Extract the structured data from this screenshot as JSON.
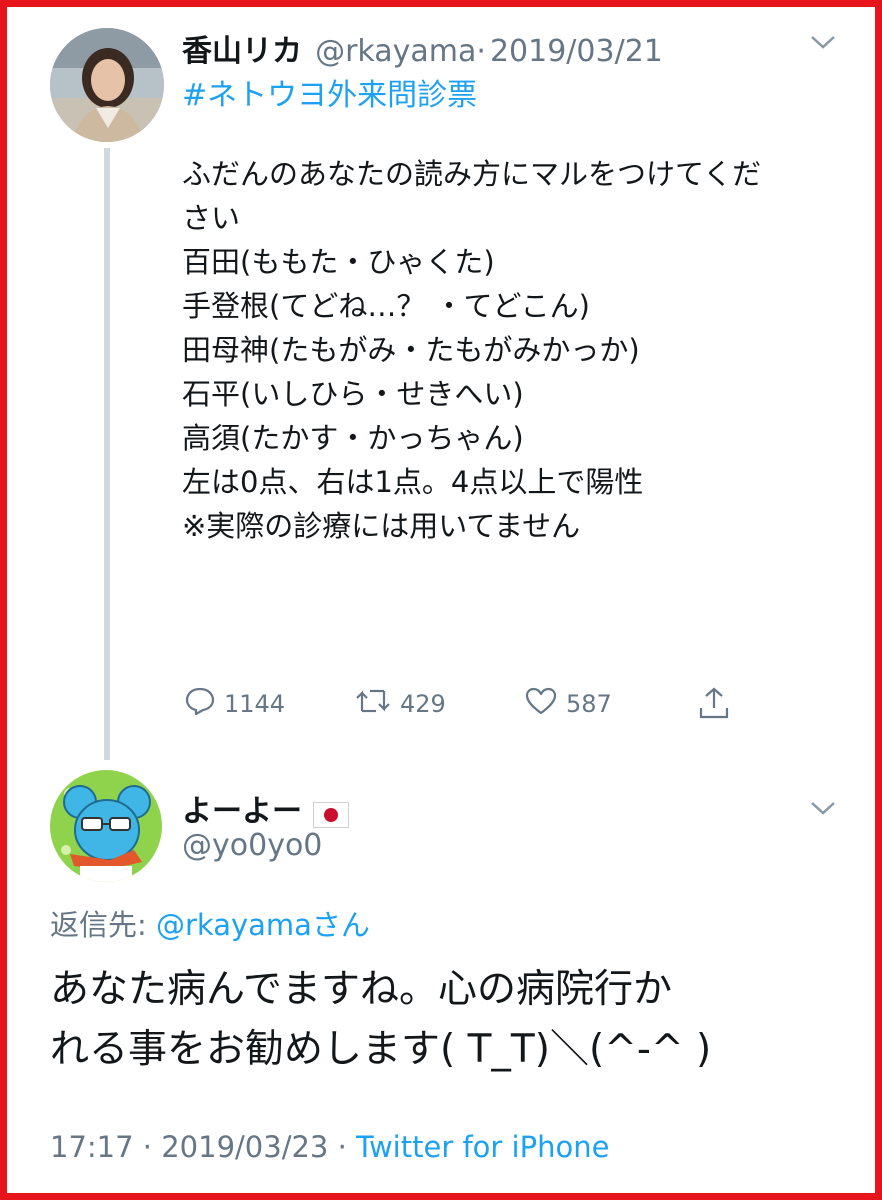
{
  "tweet1": {
    "author_name": "香山リカ",
    "handle": "@rkayama",
    "separator": "·",
    "date": "2019/03/21",
    "hashtag": "#ネトウヨ外来問診票",
    "lines": [
      "ふだんのあなたの読み方にマルをつけてくだ",
      "さい",
      "",
      "百田(ももた・ひゃくた)",
      "手登根(てどね…？ ・てどこん)",
      "田母神(たもがみ・たもがみかっか)",
      "石平(いしひら・せきへい)",
      "高須(たかす・かっちゃん)",
      "",
      "左は0点、右は1点。4点以上で陽性",
      "",
      "※実際の診療には用いてません"
    ],
    "replies": "1144",
    "retweets": "429",
    "likes": "587"
  },
  "tweet2": {
    "author_name": "よーよー",
    "flag": "🇯🇵",
    "handle": "@yo0yo0",
    "reply_to_label": "返信先: ",
    "reply_to_handle": "@rkayamaさん",
    "text_lines": [
      "あなた病んでますね。心の病院行か",
      "れる事をお勧めします( T_T)＼(^-^ )"
    ],
    "time": "17:17",
    "separator": "·",
    "date": "2019/03/23",
    "source": "Twitter for iPhone"
  },
  "colors": {
    "frame": "#e8141b",
    "link": "#1da1f2",
    "muted": "#657786",
    "thread_line": "#cfd9de"
  },
  "icons": [
    "chevron-down-icon",
    "reply-icon",
    "retweet-icon",
    "like-icon",
    "share-icon"
  ]
}
